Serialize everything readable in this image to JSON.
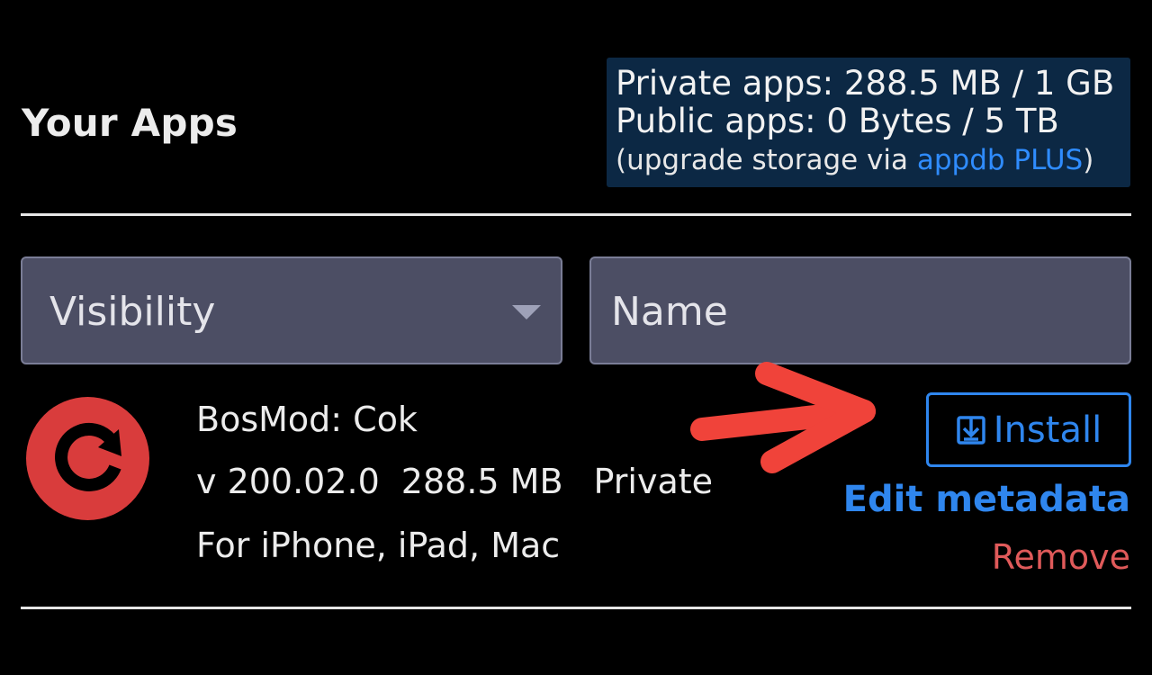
{
  "header": {
    "title": "Your Apps"
  },
  "storage": {
    "private_line": "Private apps: 288.5 MB / 1 GB",
    "public_line": "Public apps: 0 Bytes / 5 TB",
    "upgrade_prefix": "(upgrade storage via ",
    "upgrade_link": "appdb PLUS",
    "upgrade_suffix": ")"
  },
  "filters": {
    "visibility_label": "Visibility",
    "name_placeholder": "Name"
  },
  "app": {
    "name": "BosMod: Cok",
    "version": "v 200.02.0",
    "size": "288.5 MB",
    "visibility": "Private",
    "platforms": "For iPhone, iPad, Mac",
    "icon": "refresh-icon"
  },
  "actions": {
    "install_label": "Install",
    "edit_label": "Edit metadata",
    "remove_label": "Remove"
  },
  "colors": {
    "background": "#000000",
    "storage_box": "#0c2844",
    "accent_blue": "#2f86ee",
    "danger_red": "#e05a5a",
    "icon_red": "#d93c3c",
    "annotation_arrow": "#f0433a",
    "field_bg": "#4c4e64"
  }
}
